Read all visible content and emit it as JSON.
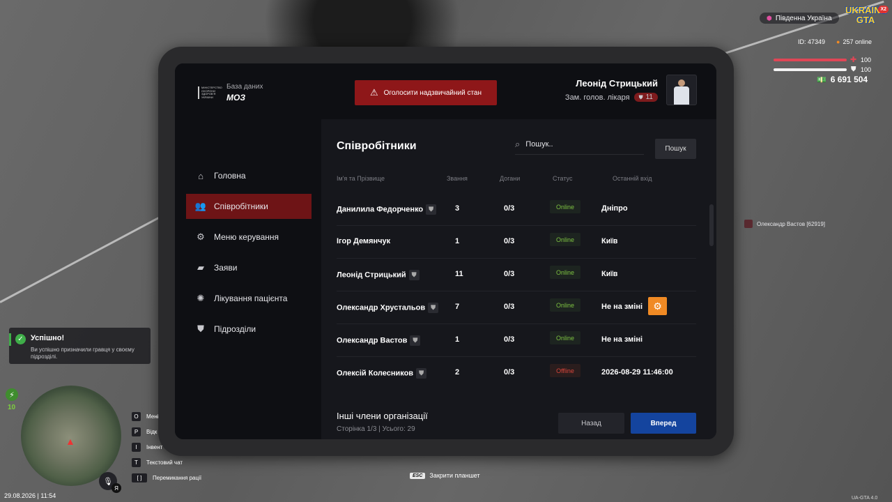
{
  "tablet": {
    "logo": {
      "org_line": "МІНІСТЕРСТВО ОХОРОНИ ЗДОРОВʼЯ УКРАЇНИ",
      "subtitle": "База даних",
      "title": "МОЗ"
    },
    "emergency_button": "Оголосити надзвичайний стан",
    "user": {
      "name": "Леонід Стрицький",
      "role": "Зам. голов. лікаря",
      "rank": "11"
    },
    "sidebar": {
      "items": [
        {
          "label": "Головна",
          "icon": "home-icon"
        },
        {
          "label": "Співробітники",
          "icon": "users-icon",
          "active": true
        },
        {
          "label": "Меню керування",
          "icon": "gear-icon"
        },
        {
          "label": "Заяви",
          "icon": "folder-icon"
        },
        {
          "label": "Лікування пацієнта",
          "icon": "virus-icon"
        },
        {
          "label": "Підрозділи",
          "icon": "shield-icon"
        }
      ]
    },
    "main": {
      "title": "Співробітники",
      "search_placeholder": "Пошук..",
      "search_button": "Пошук",
      "columns": [
        "Ім'я та Прізвище",
        "Звання",
        "Догани",
        "Статус",
        "Останній вхід"
      ],
      "rows": [
        {
          "name": "Данилила Федорченко",
          "rank": "3",
          "reprimands": "0/3",
          "status": "Online",
          "last": "Дніпро"
        },
        {
          "name": "Ігор Демянчук",
          "rank": "1",
          "reprimands": "0/3",
          "status": "Online",
          "last": "Київ"
        },
        {
          "name": "Леонід Стрицький",
          "rank": "11",
          "reprimands": "0/3",
          "status": "Online",
          "last": "Київ"
        },
        {
          "name": "Олександр Хрустальов",
          "rank": "7",
          "reprimands": "0/3",
          "status": "Online",
          "last": "Не на зміні"
        },
        {
          "name": "Олександр Вастов",
          "rank": "1",
          "reprimands": "0/3",
          "status": "Online",
          "last": "Не на зміні"
        },
        {
          "name": "Олексій Колесников",
          "rank": "2",
          "reprimands": "0/3",
          "status": "Offline",
          "last": "2026-08-29 11:46:00"
        }
      ],
      "footer_title": "Інші члени організації",
      "footer_sub": "Сторінка 1/3 | Усього: 29",
      "back_button": "Назад",
      "next_button": "Вперед"
    }
  },
  "hud": {
    "server": "Південна Україна",
    "logo": "UKRAINE GTA",
    "logo_badge": "X2",
    "player_id": "ID: 47349",
    "online": "257 online",
    "health": "100",
    "armor": "100",
    "money": "6 691 504",
    "nametag": "Олександр Вастов [62919]",
    "energy": "10",
    "binds": [
      {
        "key": "O",
        "label": "Мені"
      },
      {
        "key": "P",
        "label": "Відк"
      },
      {
        "key": "I",
        "label": "Інвент"
      },
      {
        "key": "T",
        "label": "Текстовий чат"
      },
      {
        "key": "[ ]",
        "label": "Перемикання рації"
      }
    ],
    "mic_lang": "Я",
    "datetime": "29.08.2026 | 11:54",
    "esc_key": "ESC",
    "esc_label": "Закрити планшет",
    "version": "UA-GTA 4.0"
  },
  "toast": {
    "title": "Успішно!",
    "text": "Ви успішно призначили гравця у своєму підрозділі."
  },
  "colors": {
    "accent_red": "#8e1719",
    "active_nav": "#6e1416",
    "primary_blue": "#14449e",
    "online_green": "#7dc241",
    "offline_red": "#d9453b",
    "gear_orange": "#f08a24"
  }
}
